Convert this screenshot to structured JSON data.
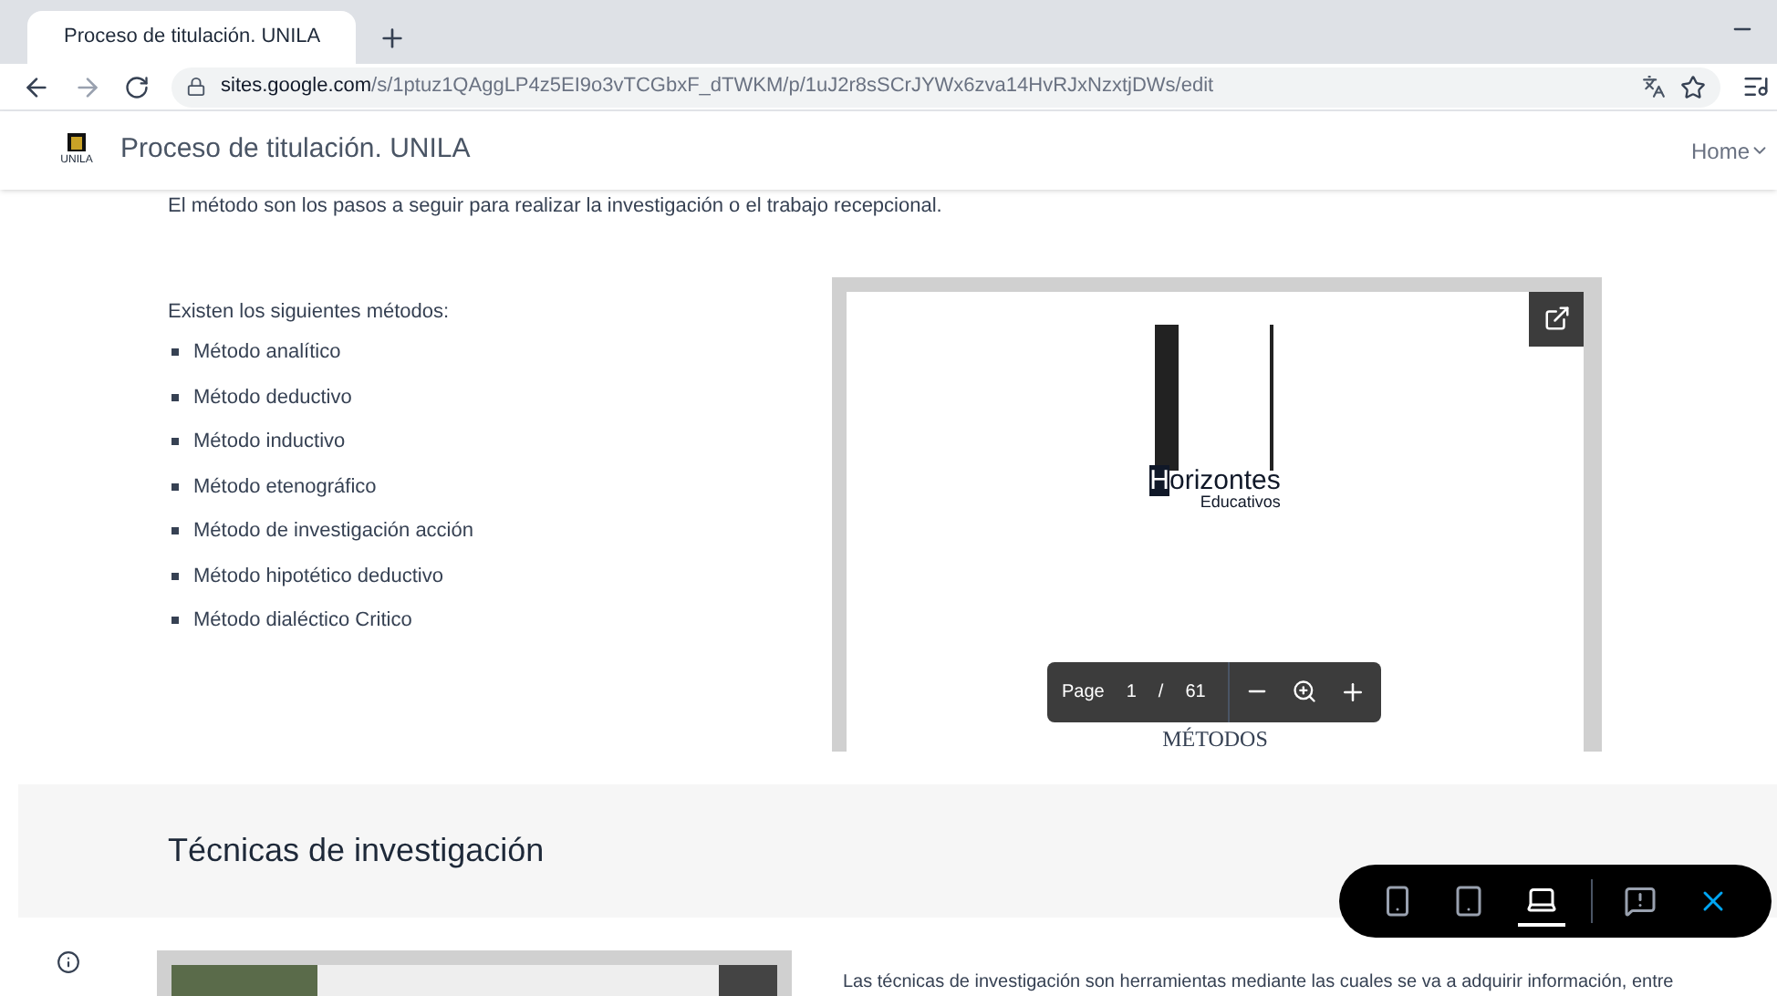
{
  "browser": {
    "tab_title": "Proceso de titulación. UNILA",
    "url_host": "sites.google.com",
    "url_path": "/s/1ptuz1QAggLP4z5EI9o3vTCGbxF_dTWKM/p/1uJ2r8sSCrJYWx6zva14HvRJxNzxtjDWs/edit"
  },
  "site": {
    "logo_text": "UNILA",
    "title": "Proceso de titulación. UNILA",
    "nav": "Home"
  },
  "intro": "El método son los pasos a seguir para realizar la investigación o el trabajo recepcional.",
  "methods_heading": "Existen los siguientes métodos:",
  "methods": [
    "Método analítico",
    "Método deductivo",
    "Método inductivo",
    "Método etenográfico",
    "Método de investigación acción",
    "Método hipotético deductivo",
    "Método dialéctico Critico"
  ],
  "pdf": {
    "brand": "orizontes",
    "brand_initial": "H",
    "brand_sub": "Educativos",
    "next_title": "MÉTODOS",
    "page_label": "Page",
    "page": "1",
    "separator": "/",
    "total": "61"
  },
  "section_title": "Técnicas de investigación",
  "techniques_text": "Las técnicas de investigación son herramientas mediante las cuales se va a adquirir información, entre",
  "preview_toolbar": [
    {
      "kind": "phone",
      "selected": false
    },
    {
      "kind": "tablet",
      "selected": false
    },
    {
      "kind": "laptop",
      "selected": true
    },
    {
      "kind": "feedback",
      "selected": false
    },
    {
      "kind": "close",
      "selected": false
    }
  ]
}
